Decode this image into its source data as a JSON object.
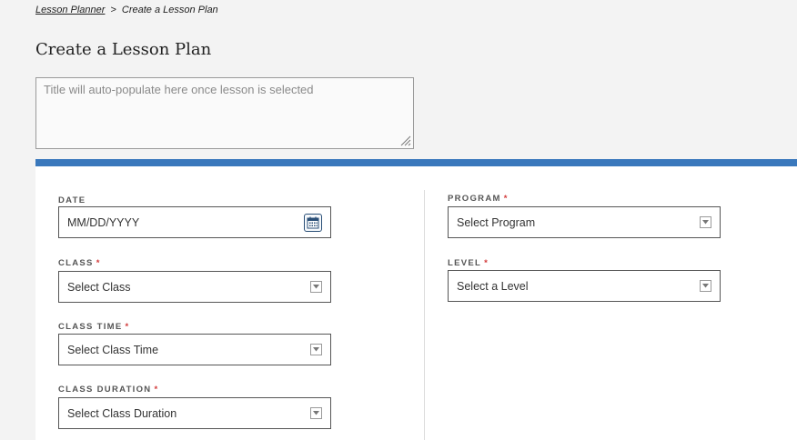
{
  "breadcrumb": {
    "parent": "Lesson Planner",
    "separator": ">",
    "current": "Create a Lesson Plan"
  },
  "page": {
    "title": "Create a Lesson Plan",
    "title_placeholder": "Title will auto-populate here once lesson is selected"
  },
  "colors": {
    "accent": "#3a78bc",
    "required": "#d23a3a",
    "background": "#f3f3f3"
  },
  "form": {
    "date": {
      "label": "DATE",
      "value": "MM/DD/YYYY",
      "icon": "calendar-icon"
    },
    "class": {
      "label": "CLASS",
      "required": "*",
      "value": "Select Class"
    },
    "class_time": {
      "label": "CLASS TIME",
      "required": "*",
      "value": "Select Class Time"
    },
    "class_duration": {
      "label": "CLASS DURATION",
      "required": "*",
      "value": "Select Class Duration"
    },
    "program": {
      "label": "PROGRAM",
      "required": "*",
      "value": "Select Program"
    },
    "level": {
      "label": "LEVEL",
      "required": "*",
      "value": "Select a Level"
    }
  }
}
